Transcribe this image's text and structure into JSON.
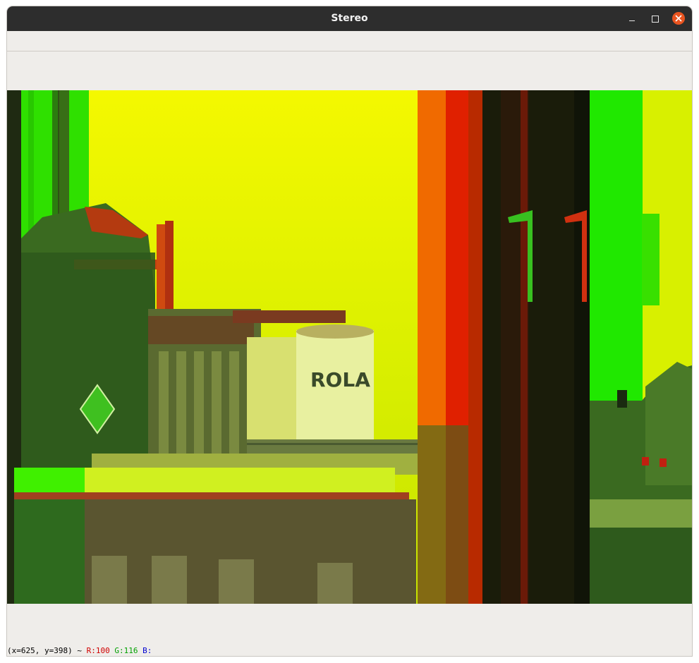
{
  "window": {
    "title": "Stereo"
  },
  "statusbar": {
    "coords": "(x=625, y=398) ~",
    "r": "R:100",
    "g": "G:116",
    "b": "B:"
  },
  "image": {
    "description_icon": "anaglyph-image",
    "sign_text": "ROLA"
  },
  "colors": {
    "titlebar": "#2d2d2d",
    "close": "#e95420",
    "panel": "#efedea"
  }
}
